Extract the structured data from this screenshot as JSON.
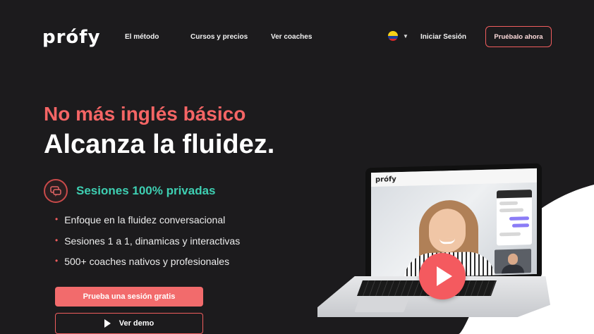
{
  "brand": {
    "logo_text": "prófy"
  },
  "nav": {
    "links": [
      "El método",
      "Cursos y precios",
      "Ver coaches"
    ],
    "country_flag": "colombia-flag-icon",
    "login_label": "Iniciar Sesión",
    "cta_label": "Pruébalo ahora"
  },
  "hero": {
    "subtitle": "No más inglés básico",
    "title": "Alcanza la fluidez.",
    "feature_title": "Sesiones 100% privadas",
    "bullets": [
      "Enfoque en la fluidez conversacional",
      "Sesiones 1 a 1, dinamicas y interactivas",
      "500+ coaches nativos y profesionales"
    ],
    "primary_button": "Prueba una sesión gratis",
    "secondary_button": "Ver demo"
  },
  "mockup": {
    "screen_logo": "prófy"
  },
  "colors": {
    "background": "#1c1b1d",
    "accent": "#f05d5e",
    "teal": "#3ecfb2",
    "white": "#ffffff"
  }
}
